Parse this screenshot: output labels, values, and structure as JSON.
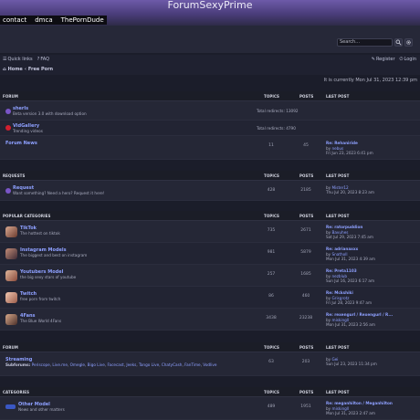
{
  "site": {
    "title": "ForumSexyPrime",
    "links": [
      "contact",
      "dmca",
      "ThePornDude"
    ]
  },
  "search": {
    "placeholder": "Search…"
  },
  "nav": {
    "quick_links": "Quick links",
    "faq": "FAQ",
    "register": "Register",
    "login": "Login",
    "breadcrumb_home": "Home",
    "breadcrumb_sep": "‹",
    "breadcrumb_current": "Free Porn"
  },
  "datebar": "It is currently Mon Jul 31, 2023 12:39 pm",
  "columns": {
    "topics": "TOPICS",
    "posts": "POSTS",
    "last_post": "LAST POST"
  },
  "sections": {
    "forum1": {
      "heading": "FORUM",
      "rows": [
        {
          "title": "sherls",
          "desc": "Beta version 3.0 with download option",
          "redirects": "Total redirects: 13092",
          "icon_color": "#7a55c7"
        },
        {
          "title": "VidGallery",
          "desc": "Trending videos",
          "redirects": "Total redirects: 4790",
          "icon_color": "#d01f2f"
        },
        {
          "title": "Forum News",
          "desc": "",
          "topics": "11",
          "posts": "45",
          "lp_title": "Re: Rehaniride",
          "lp_by": "by",
          "lp_user": "nebus",
          "lp_date": "Fri Jun 23, 2023 6:41 pm"
        }
      ]
    },
    "requests": {
      "heading": "REQUESTS",
      "rows": [
        {
          "title": "Request",
          "desc": "Want something? Need a hero? Request it here!",
          "topics": "428",
          "posts": "2185",
          "lp_title": "",
          "lp_by": "by",
          "lp_user": "Mister12",
          "lp_date": "Thu Jul 20, 2023 8:23 am",
          "icon_color": "#7a55c7"
        }
      ]
    },
    "popular": {
      "heading": "POPULAR CATEGORIES",
      "rows": [
        {
          "title": "TikTok",
          "desc": "The hottest on tiktok",
          "topics": "735",
          "posts": "2671",
          "lp_title": "Re: ratorpuddion",
          "lp_user": "Bavuhes",
          "lp_by": "by",
          "lp_date": "Sat Jul 29, 2023 7:45 am"
        },
        {
          "title": "Instagram Models",
          "desc": "The biggest and best on instagram",
          "topics": "981",
          "posts": "5879",
          "lp_title": "Re: adrianaxxx",
          "lp_user": "Snatholl",
          "lp_by": "by",
          "lp_date": "Mon Jul 31, 2023 4:39 am"
        },
        {
          "title": "Youtubers Model",
          "desc": "the big sexy stars of youtube",
          "topics": "257",
          "posts": "1685",
          "lp_title": "Re: Preta1103",
          "lp_user": "nezblub",
          "lp_by": "by",
          "lp_date": "Sun Jul 16, 2023 6:17 am"
        },
        {
          "title": "Twitch",
          "desc": "free porn from twitch",
          "topics": "86",
          "posts": "460",
          "lp_title": "Re: Mckshiki",
          "lp_user": "Grisgrotz",
          "lp_by": "by",
          "lp_date": "Fri Jul 28, 2023 9:47 am"
        },
        {
          "title": "4Fans",
          "desc": "The Blue World 4Fans",
          "topics": "3438",
          "posts": "23238",
          "lp_title": "Re: rexengurl / Rexengurl / R...",
          "lp_user": "miskingll",
          "lp_by": "by",
          "lp_date": "Mon Jul 31, 2023 2:56 am"
        }
      ]
    },
    "forum2": {
      "heading": "FORUM",
      "rows": [
        {
          "title": "Streaming",
          "subforums_label": "Subforums:",
          "subforums": [
            "Periscope",
            "Live.me",
            "Omegle",
            "Bigo Live",
            "Facecast",
            "Jeeks",
            "Tango Live",
            "ChatyCash",
            "FanTime",
            "Vodlive"
          ],
          "topics": "63",
          "posts": "203",
          "lp_title": "",
          "lp_by": "by",
          "lp_user": "Gei",
          "lp_date": "Sun Jul 23, 2023 11:34 pm"
        }
      ]
    },
    "categories": {
      "heading": "CATEGORIES",
      "rows": [
        {
          "title": "Other Model",
          "desc": "News and other matters",
          "topics": "489",
          "posts": "1951",
          "lp_title": "Re: meganhilton / Meganhilton",
          "lp_user": "miskingll",
          "lp_by": "by",
          "lp_date": "Mon Jul 31, 2023 2:47 am"
        }
      ]
    }
  }
}
